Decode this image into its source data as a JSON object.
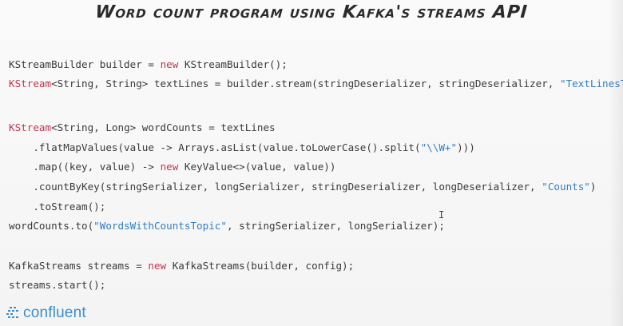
{
  "title": "Word count program using Kafka's streams API",
  "code": {
    "l1": {
      "a": "KStreamBuilder builder = ",
      "b": "new",
      "c": " KStreamBuilder();"
    },
    "l2": {
      "a": "KStream",
      "b": "<String, String> textLines = builder.stream(stringDeserializer, stringDeserializer, ",
      "c": "\"TextLinesTopic\"",
      "d": ");"
    },
    "l3": {
      "a": "KStream",
      "b": "<String, Long> wordCounts = textLines"
    },
    "l4": {
      "a": "    .flatMapValues(value -> Arrays.asList(value.toLowerCase().split(",
      "b": "\"\\\\W+\"",
      "c": ")))"
    },
    "l5": {
      "a": "    .map((key, value) -> ",
      "b": "new",
      "c": " KeyValue<>(value, value))"
    },
    "l6": {
      "a": "    .countByKey(stringSerializer, longSerializer, stringDeserializer, longDeserializer, ",
      "b": "\"Counts\"",
      "c": ")"
    },
    "l7": {
      "a": "    .toStream();"
    },
    "l8": {
      "a": "wordCounts.to(",
      "b": "\"WordsWithCountsTopic\"",
      "c": ", stringSerializer, longSerializer);"
    },
    "l9": {
      "a": "KafkaStreams streams = ",
      "b": "new",
      "c": " KafkaStreams(builder, config);"
    },
    "l10": {
      "a": "streams.start();"
    }
  },
  "cursor_glyph": "I",
  "logo": {
    "text": "confluent",
    "icon": "confluent-logo-icon",
    "color": "#3c8dd0"
  },
  "colors": {
    "keyword": "#c2354f",
    "string": "#2f7ec4",
    "text": "#3a3a3a"
  }
}
